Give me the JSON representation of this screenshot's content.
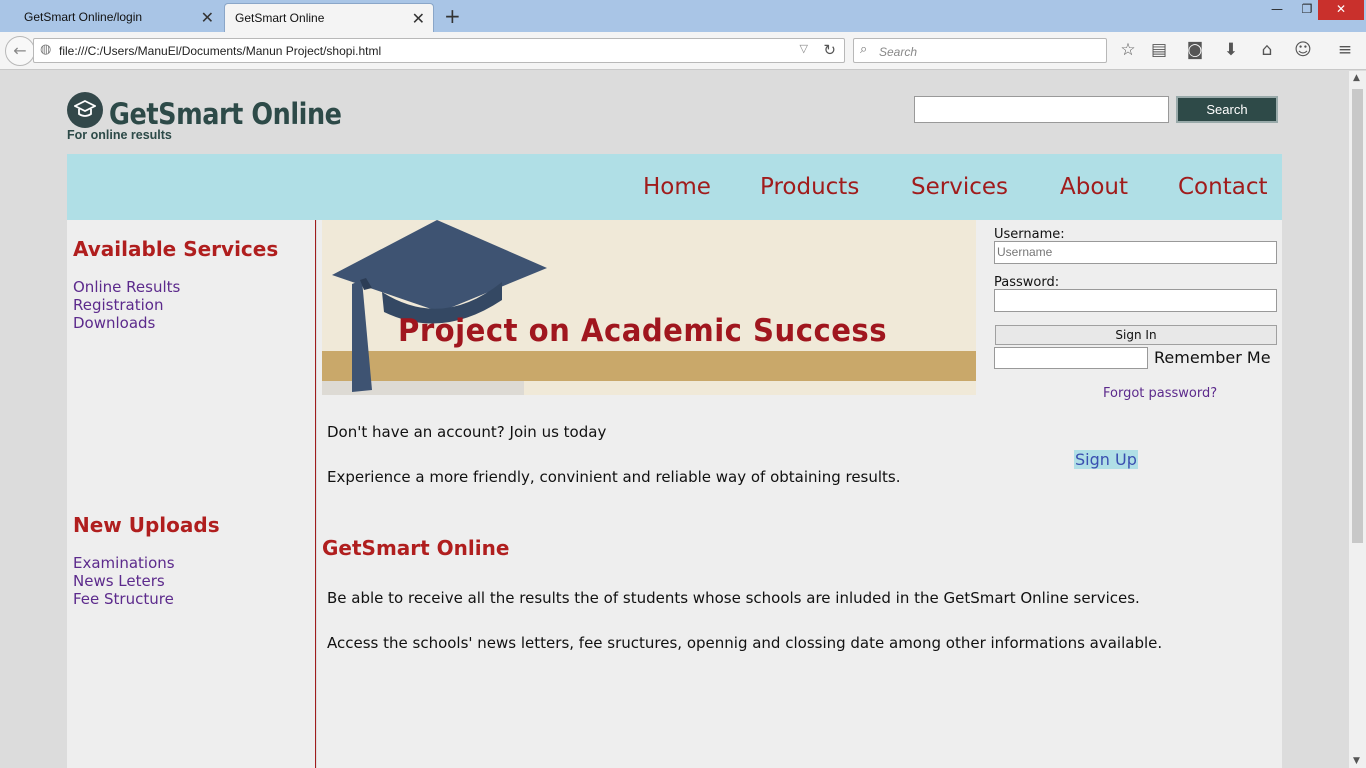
{
  "browser": {
    "tabs": [
      {
        "title": "GetSmart Online/login"
      },
      {
        "title": "GetSmart Online"
      }
    ],
    "url": "file:///C:/Users/ManuEl/Documents/Manun Project/shopi.html",
    "search_placeholder": "Search"
  },
  "site": {
    "name": "GetSmart Online",
    "tagline": "For online results",
    "search_button": "Search",
    "menu": [
      "Home",
      "Products",
      "Services",
      "About",
      "Contact"
    ]
  },
  "sidebar": {
    "services_heading": "Available Services",
    "services": [
      "Online Results",
      "Registration",
      "Downloads"
    ],
    "uploads_heading": "New Uploads",
    "uploads": [
      "Examinations",
      "News Leters",
      "Fee Structure"
    ]
  },
  "banner": {
    "title": "Project on Academic Success"
  },
  "main": {
    "join_text": "Don't have an account? Join us today",
    "experience_text": "Experience a more friendly, convinient and reliable way of obtaining results.",
    "heading": "GetSmart Online",
    "paragraph1": "Be able to receive all the results the of students whose schools are inluded in the GetSmart Online services.",
    "paragraph2": "Access the schools' news letters, fee sructures, opennig and clossing date among other informations available."
  },
  "login": {
    "username_label": "Username:",
    "username_placeholder": "Username",
    "password_label": "Password:",
    "signin_button": "Sign In",
    "remember_label": "Remember Me",
    "forgot_link": "Forgot password?",
    "signup_link": "Sign Up"
  }
}
